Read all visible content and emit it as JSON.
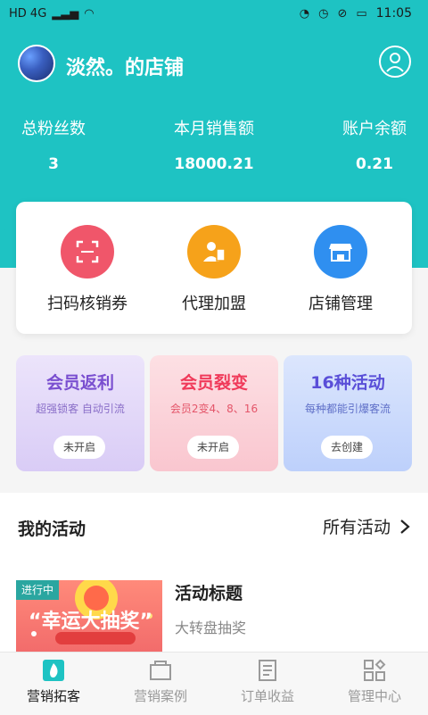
{
  "status_bar": {
    "network": "HD 4G",
    "time": "11:05"
  },
  "shop": {
    "title": "淡然。的店铺"
  },
  "stats": [
    {
      "label": "总粉丝数",
      "value": "3"
    },
    {
      "label": "本月销售额",
      "value": "18000.21"
    },
    {
      "label": "账户余额",
      "value": "0.21"
    }
  ],
  "quick_actions": [
    {
      "label": "扫码核销券",
      "icon": "scan-icon",
      "color": "#f0566a"
    },
    {
      "label": "代理加盟",
      "icon": "agent-icon",
      "color": "#f6a21a"
    },
    {
      "label": "店铺管理",
      "icon": "store-icon",
      "color": "#2f8ff0"
    }
  ],
  "promos": [
    {
      "title": "会员返利",
      "subtitle": "超强锁客 自动引流",
      "button": "未开启",
      "title_color": "#7a4fd0"
    },
    {
      "title": "会员裂变",
      "subtitle": "会员2变4、8、16",
      "button": "未开启",
      "title_color": "#f03a5a"
    },
    {
      "title": "16种活动",
      "subtitle": "每种都能引爆客流",
      "button": "去创建",
      "title_color": "#5a4fd8"
    }
  ],
  "activities": {
    "section_title": "我的活动",
    "all_link": "所有活动",
    "item": {
      "status": "进行中",
      "thumb_text": "“幸运大抽奖”",
      "title": "活动标题",
      "subtitle": "大转盘抽奖"
    }
  },
  "tabs": [
    {
      "label": "营销拓客",
      "active": true,
      "icon": "flame-icon"
    },
    {
      "label": "营销案例",
      "active": false,
      "icon": "case-icon"
    },
    {
      "label": "订单收益",
      "active": false,
      "icon": "order-icon"
    },
    {
      "label": "管理中心",
      "active": false,
      "icon": "grid-icon"
    }
  ],
  "colors": {
    "brand": "#1ec3c3",
    "active_tab": "#1a1a1a",
    "inactive_tab": "#9a9a9a"
  }
}
